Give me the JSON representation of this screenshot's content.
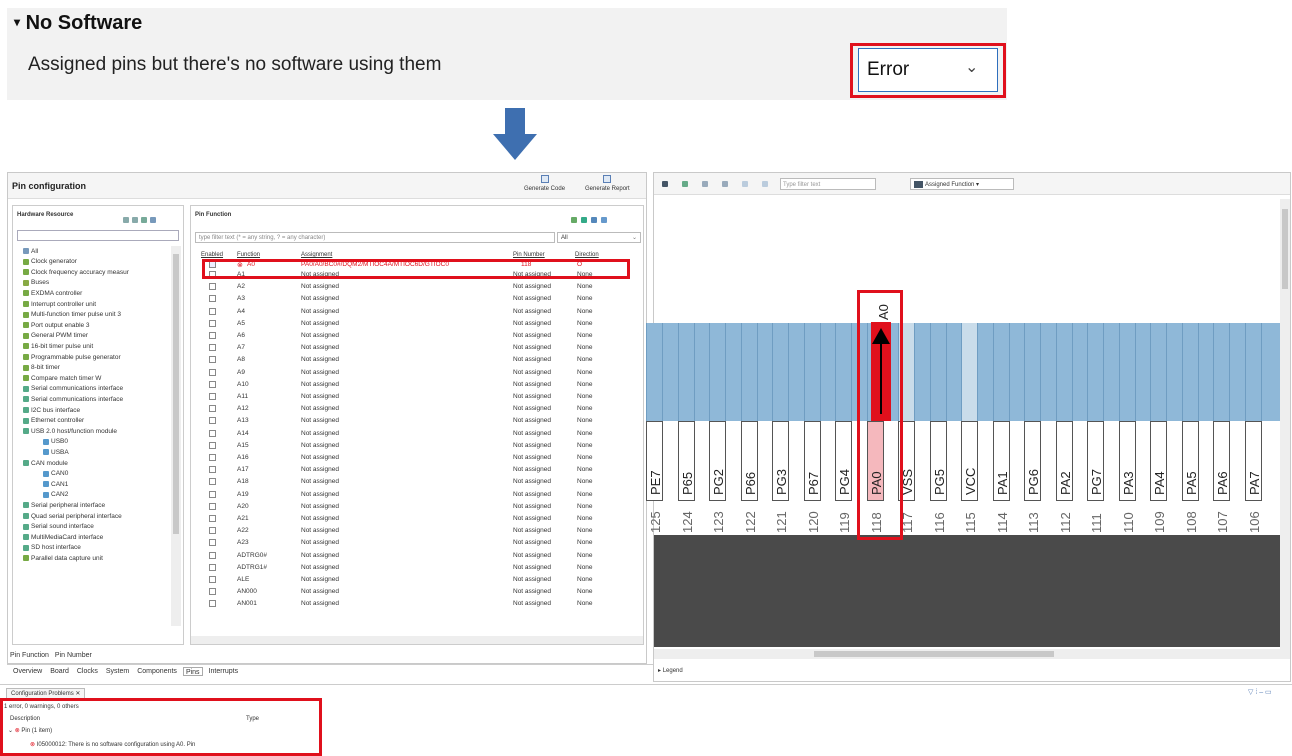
{
  "preference": {
    "title": "No Software",
    "description": "Assigned pins but there's no software using them",
    "severity_value": "Error"
  },
  "ide": {
    "pin_config_title": "Pin configuration",
    "generate_code": "Generate Code",
    "generate_report": "Generate Report",
    "hw_resource_title": "Hardware Resource",
    "pin_function_title": "Pin Function",
    "filter_placeholder": "type filter text (* = any string, ? = any character)",
    "filter_scope": "All",
    "columns": [
      "Enabled",
      "Function",
      "Assignment",
      "Pin Number",
      "Direction"
    ],
    "tree": [
      "All",
      "Clock generator",
      "Clock frequency accuracy measur",
      "Buses",
      "EXDMA controller",
      "Interrupt controller unit",
      "Multi-function timer pulse unit 3",
      "Port output enable 3",
      "General PWM timer",
      "16-bit timer pulse unit",
      "Programmable pulse generator",
      "8-bit timer",
      "Compare match timer W",
      "Serial communications interface",
      "Serial communications interface",
      "I2C bus interface",
      "Ethernet controller",
      "USB 2.0 host/function module",
      "USB0",
      "USBA",
      "CAN module",
      "CAN0",
      "CAN1",
      "CAN2",
      "Serial peripheral interface",
      "Quad serial peripheral interface",
      "Serial sound interface",
      "MultiMediaCard interface",
      "SD host interface",
      "Parallel data capture unit"
    ],
    "selected_row": {
      "function": "A0",
      "assignment": "PA0/A0/BC0#/DQM2/MTIOC4A/MTIOC6D/GTIOC0",
      "pin_number": "118",
      "direction": "O"
    },
    "functions": [
      "A1",
      "A2",
      "A3",
      "A4",
      "A5",
      "A6",
      "A7",
      "A8",
      "A9",
      "A10",
      "A11",
      "A12",
      "A13",
      "A14",
      "A15",
      "A16",
      "A17",
      "A18",
      "A19",
      "A20",
      "A21",
      "A22",
      "A23",
      "ADTRG0#",
      "ADTRG1#",
      "ALE",
      "AN000",
      "AN001"
    ],
    "not_assigned": "Not assigned",
    "none": "None",
    "bottom_tabs_1": [
      "Pin Function",
      "Pin Number"
    ],
    "bottom_tabs_2": [
      "Overview",
      "Board",
      "Clocks",
      "System",
      "Components",
      "Pins",
      "Interrupts"
    ],
    "filter_text_placeholder": "Type filter text",
    "assigned_function": "Assigned Function",
    "legend": "Legend",
    "highlighted_function": "A0",
    "pins": [
      {
        "num": "125",
        "name": "PE7"
      },
      {
        "num": "124",
        "name": "P65"
      },
      {
        "num": "123",
        "name": "PG2"
      },
      {
        "num": "122",
        "name": "P66"
      },
      {
        "num": "121",
        "name": "PG3"
      },
      {
        "num": "120",
        "name": "P67"
      },
      {
        "num": "119",
        "name": "PG4"
      },
      {
        "num": "118",
        "name": "PA0"
      },
      {
        "num": "117",
        "name": "VSS"
      },
      {
        "num": "116",
        "name": "PG5"
      },
      {
        "num": "115",
        "name": "VCC"
      },
      {
        "num": "114",
        "name": "PA1"
      },
      {
        "num": "113",
        "name": "PG6"
      },
      {
        "num": "112",
        "name": "PA2"
      },
      {
        "num": "111",
        "name": "PG7"
      },
      {
        "num": "110",
        "name": "PA3"
      },
      {
        "num": "109",
        "name": "PA4"
      },
      {
        "num": "108",
        "name": "PA5"
      },
      {
        "num": "107",
        "name": "PA6"
      },
      {
        "num": "106",
        "name": "PA7"
      }
    ],
    "problems_tab": "Configuration Problems",
    "problems_summary": "1 error, 0 warnings, 0 others",
    "problems_col_desc": "Description",
    "problems_col_type": "Type",
    "problems_group": "Pin (1 item)",
    "problems_item": "I05000012: There is no software configuration using A0.",
    "problems_item_type": "Pin"
  },
  "colors": {
    "error_red": "#e0101c",
    "pin_blue": "#8fb8d8",
    "pin_light": "#c9dcea",
    "chip_dark": "#4a4a4a",
    "arrow_blue": "#3e6fb0"
  }
}
